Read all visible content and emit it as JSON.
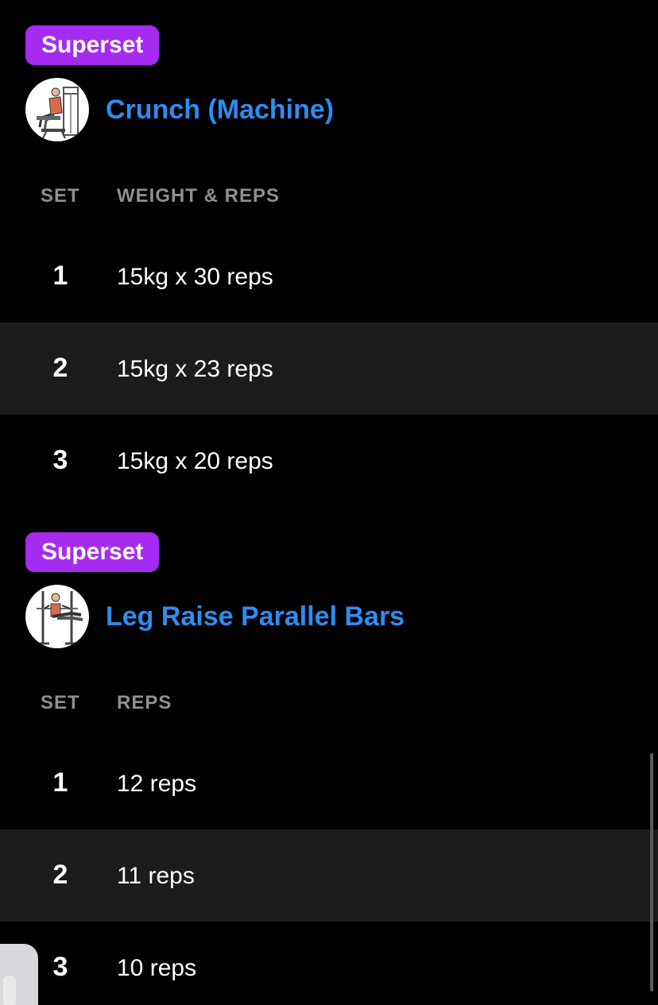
{
  "exercises": [
    {
      "badge": "Superset",
      "title": "Crunch (Machine)",
      "icon": "crunch-machine-icon",
      "headers": {
        "set": "SET",
        "value": "WEIGHT & REPS"
      },
      "sets": [
        {
          "num": "1",
          "value": "15kg x 30 reps"
        },
        {
          "num": "2",
          "value": "15kg x 23 reps"
        },
        {
          "num": "3",
          "value": "15kg x 20 reps"
        }
      ]
    },
    {
      "badge": "Superset",
      "title": "Leg Raise Parallel Bars",
      "icon": "leg-raise-parallel-bars-icon",
      "headers": {
        "set": "SET",
        "value": "REPS"
      },
      "sets": [
        {
          "num": "1",
          "value": "12 reps"
        },
        {
          "num": "2",
          "value": "11 reps"
        },
        {
          "num": "3",
          "value": "10 reps"
        }
      ]
    }
  ],
  "colors": {
    "background": "#000000",
    "badge": "#a62bf0",
    "title": "#2f8cf0",
    "alt_row": "#1c1c1e",
    "header_text": "#8e8e93"
  }
}
